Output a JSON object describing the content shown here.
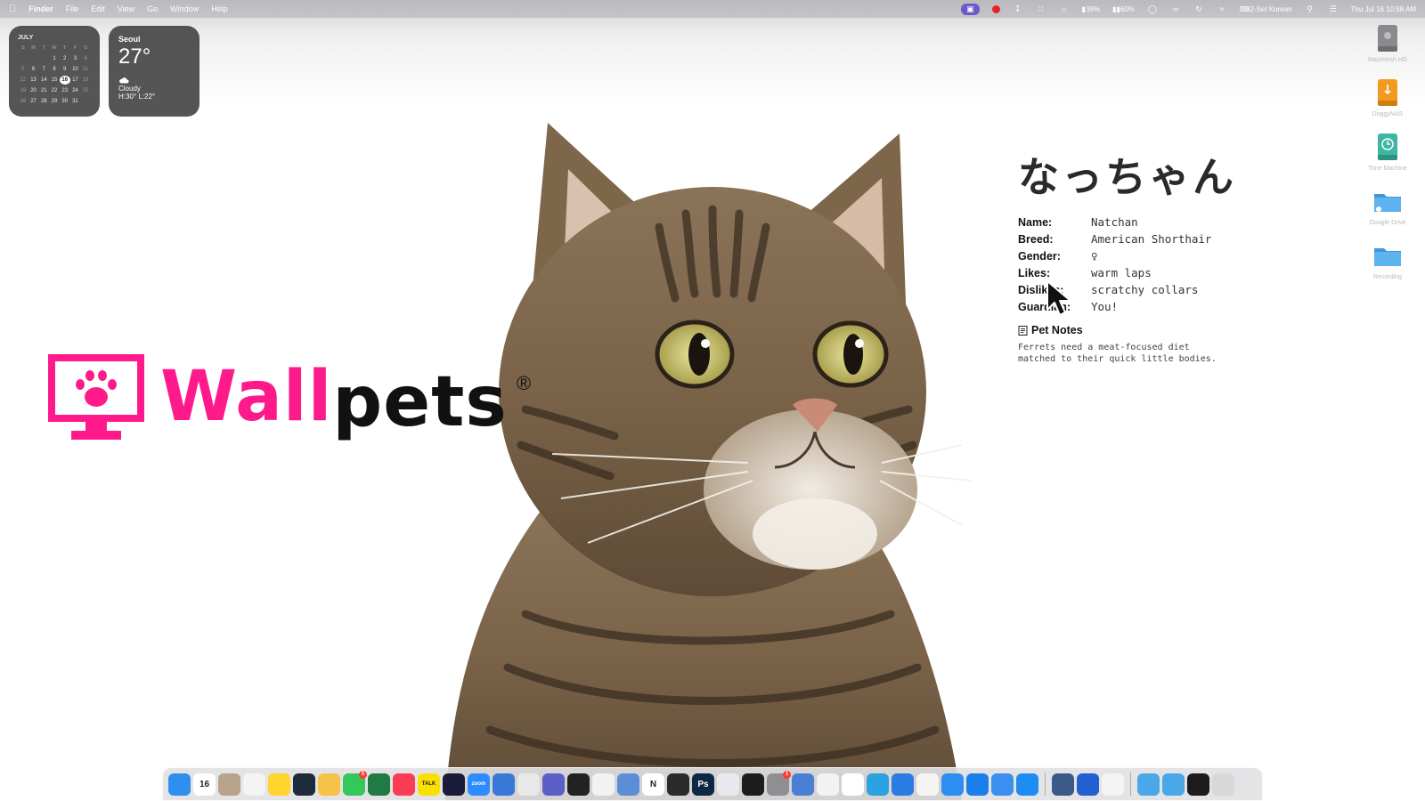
{
  "menubar": {
    "apple_icon": "apple-logo-icon",
    "app_name": "Finder",
    "menus": [
      "File",
      "Edit",
      "View",
      "Go",
      "Window",
      "Help"
    ],
    "battery_1": "39%",
    "battery_2": "60%",
    "input_source": "2-Set Korean",
    "datetime": "Thu Jul 16  10:58 AM"
  },
  "calendar_widget": {
    "month": "JULY",
    "weekdays": [
      "S",
      "M",
      "T",
      "W",
      "T",
      "F",
      "S"
    ],
    "weeks": [
      [
        "",
        "",
        "",
        "1",
        "2",
        "3",
        "4"
      ],
      [
        "5",
        "6",
        "7",
        "8",
        "9",
        "10",
        "11"
      ],
      [
        "12",
        "13",
        "14",
        "15",
        "16",
        "17",
        "18"
      ],
      [
        "19",
        "20",
        "21",
        "22",
        "23",
        "24",
        "25"
      ],
      [
        "26",
        "27",
        "28",
        "29",
        "30",
        "31",
        ""
      ]
    ],
    "today": "16"
  },
  "weather_widget": {
    "city": "Seoul",
    "temperature": "27°",
    "condition": "Cloudy",
    "high_low": "H:30° L:22°"
  },
  "desktop_icons": [
    {
      "label": "Macintosh HD",
      "icon": "hard-drive-icon",
      "color": "#8a8a8e"
    },
    {
      "label": "DoggyNAS",
      "icon": "external-drive-icon",
      "color": "#f29a1f"
    },
    {
      "label": "Time Machine",
      "icon": "time-machine-drive-icon",
      "color": "#3fb6a2"
    },
    {
      "label": "Google Drive",
      "icon": "folder-icon",
      "color": "#4aa8e8"
    },
    {
      "label": "Recording",
      "icon": "folder-icon",
      "color": "#4aa8e8"
    }
  ],
  "logo": {
    "text_pink": "Wall",
    "text_black": "pets",
    "registered": "®",
    "brand_color": "#ff1a8c"
  },
  "profile": {
    "japanese_name": "なっちゃん",
    "fields": [
      {
        "key": "Name:",
        "value": "Natchan"
      },
      {
        "key": "Breed:",
        "value": "American Shorthair"
      },
      {
        "key": "Gender:",
        "value": "♀"
      },
      {
        "key": "Likes:",
        "value": "warm laps"
      },
      {
        "key": "Dislikes:",
        "value": "scratchy collars"
      },
      {
        "key": "Guardian:",
        "value": "You!"
      }
    ],
    "notes_title": "Pet Notes",
    "notes_body": "Ferrets need a meat-focused diet\nmatched to their quick little bodies."
  },
  "dock": {
    "apps": [
      {
        "name": "Finder",
        "icon": "finder-icon",
        "color": "#2f8ff0"
      },
      {
        "name": "Calendar",
        "icon": "calendar-icon",
        "color": "#ffffff",
        "glyph": "16"
      },
      {
        "name": "Contacts",
        "icon": "contacts-icon",
        "color": "#b8a48a"
      },
      {
        "name": "Reminders",
        "icon": "reminders-icon",
        "color": "#f4f4f4"
      },
      {
        "name": "Notes",
        "icon": "notes-icon",
        "color": "#ffd52e"
      },
      {
        "name": "Activity Monitor",
        "icon": "activity-monitor-icon",
        "color": "#1d2b3a"
      },
      {
        "name": "Photos Folder",
        "icon": "folder-yellow-icon",
        "color": "#f5c24a"
      },
      {
        "name": "Messages",
        "icon": "messages-icon",
        "color": "#34c759",
        "badge": "5"
      },
      {
        "name": "Excel",
        "icon": "excel-icon",
        "color": "#1f7a43"
      },
      {
        "name": "Music",
        "icon": "music-icon",
        "color": "#fa3c55"
      },
      {
        "name": "KakaoTalk",
        "icon": "kakaotalk-icon",
        "color": "#f9e000",
        "glyph": "TALK"
      },
      {
        "name": "Hyper",
        "icon": "terminal-icon",
        "color": "#1b1b3a"
      },
      {
        "name": "Zoom",
        "icon": "zoom-icon",
        "color": "#2d8cff",
        "glyph": "zoom"
      },
      {
        "name": "Keynote",
        "icon": "keynote-icon",
        "color": "#3a78d8"
      },
      {
        "name": "Chrome",
        "icon": "chrome-icon",
        "color": "#e8e8e8"
      },
      {
        "name": "Teams",
        "icon": "teams-icon",
        "color": "#5b5fc7"
      },
      {
        "name": "Codex",
        "icon": "codex-icon",
        "color": "#222222"
      },
      {
        "name": "Perplexity",
        "icon": "sparkle-icon",
        "color": "#f2f2f2"
      },
      {
        "name": "Preview",
        "icon": "preview-icon",
        "color": "#5a8fd8"
      },
      {
        "name": "Notion",
        "icon": "notion-icon",
        "color": "#ffffff",
        "glyph": "N"
      },
      {
        "name": "Launchpad",
        "icon": "launchpad-icon",
        "color": "#2b2b2b"
      },
      {
        "name": "Photoshop",
        "icon": "photoshop-icon",
        "color": "#0f2744",
        "glyph": "Ps"
      },
      {
        "name": "Affinity",
        "icon": "affinity-icon",
        "color": "#e8e8ee"
      },
      {
        "name": "ChatGPT",
        "icon": "chatgpt-icon",
        "color": "#1c1c1c"
      },
      {
        "name": "System Settings",
        "icon": "gear-icon",
        "color": "#8e8e93",
        "badge": "1"
      },
      {
        "name": "Simulator",
        "icon": "simulator-icon",
        "color": "#4a7fd6"
      },
      {
        "name": "Google Drive",
        "icon": "google-drive-icon",
        "color": "#f2f2f2"
      },
      {
        "name": "CapCut",
        "icon": "capcut-icon",
        "color": "#ffffff"
      },
      {
        "name": "Telegram",
        "icon": "telegram-icon",
        "color": "#2aa3e0"
      },
      {
        "name": "Xcode",
        "icon": "xcode-icon",
        "color": "#2a7be4"
      },
      {
        "name": "Slack",
        "icon": "slack-icon",
        "color": "#f4f4f4"
      },
      {
        "name": "Safari",
        "icon": "safari-icon",
        "color": "#2d8df0"
      },
      {
        "name": "Freeform",
        "icon": "freeform-icon",
        "color": "#1a7fe8"
      },
      {
        "name": "TestFlight",
        "icon": "testflight-icon",
        "color": "#3a8ff0"
      },
      {
        "name": "App Store",
        "icon": "app-store-icon",
        "color": "#1d8cf3"
      }
    ],
    "extras": [
      {
        "name": "Hand Mirror",
        "icon": "mirror-icon",
        "color": "#3b5a8a"
      },
      {
        "name": "Windows App",
        "icon": "windows-icon",
        "color": "#2060d0"
      },
      {
        "name": "Photos",
        "icon": "photos-icon",
        "color": "#f4f4f4"
      }
    ],
    "stacks": [
      {
        "name": "Applications",
        "icon": "folder-icon",
        "color": "#4aa8e8"
      },
      {
        "name": "Downloads",
        "icon": "folder-icon",
        "color": "#4aa8e8"
      },
      {
        "name": "Screen",
        "icon": "window-icon",
        "color": "#1c1c1c"
      },
      {
        "name": "Trash",
        "icon": "trash-icon",
        "color": "#d8d8d8"
      }
    ]
  }
}
